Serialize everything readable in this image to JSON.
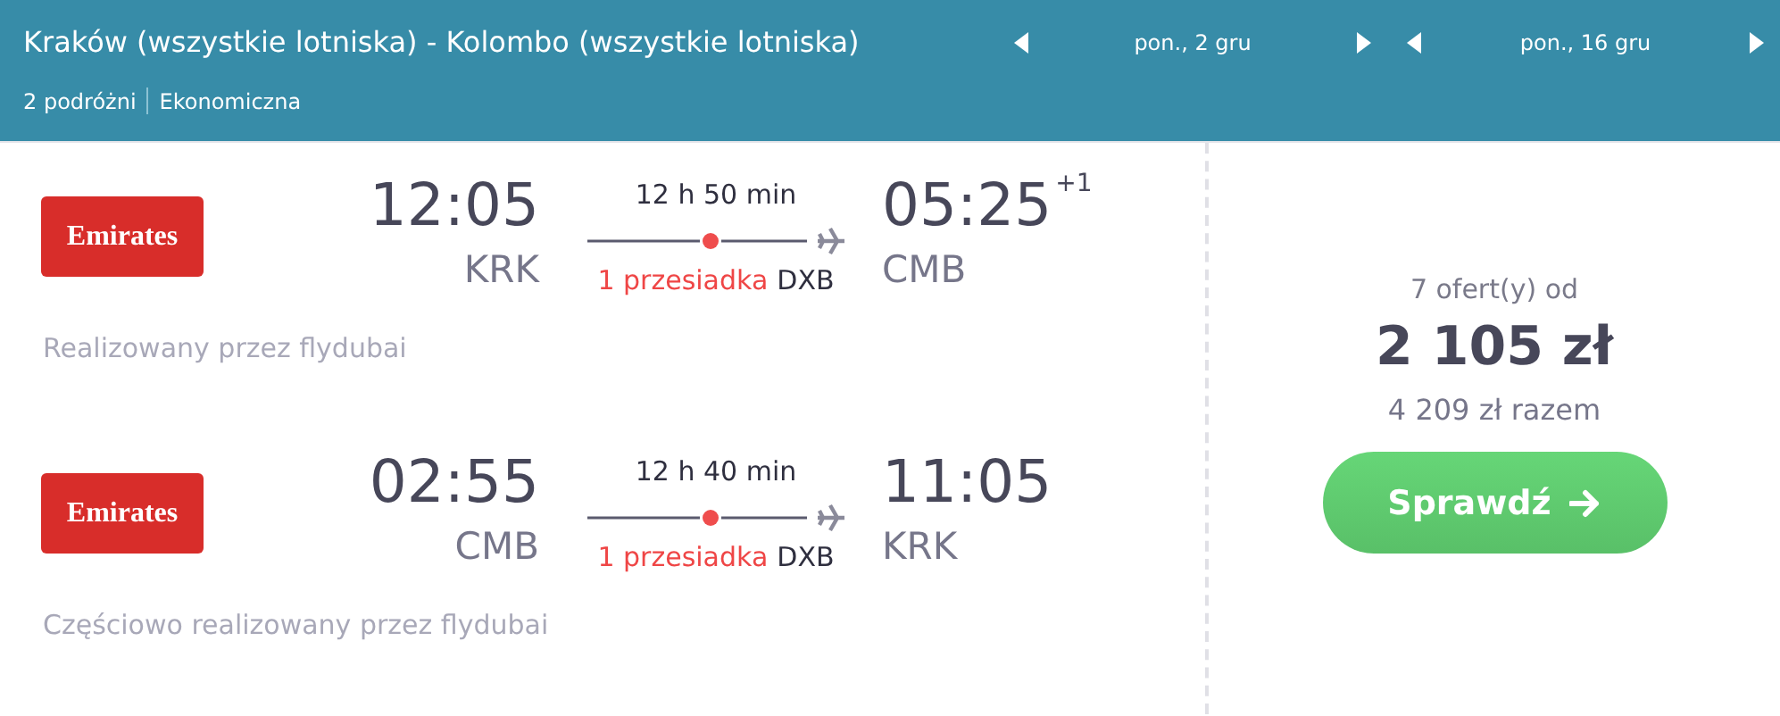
{
  "header": {
    "route": "Kraków (wszystkie lotniska) - Kolombo (wszystkie lotniska)",
    "travellers": "2 podróżni",
    "cabin": "Ekonomiczna",
    "dates": [
      "pon., 2 gru",
      "pon., 16 gru"
    ]
  },
  "legs": [
    {
      "airline": "Emirates",
      "departure_time": "12:05",
      "departure_airport": "KRK",
      "duration": "12 h 50 min",
      "stops": "1 przesiadka",
      "stop_airport": "DXB",
      "arrival_time": "05:25",
      "day_offset": "+1",
      "arrival_airport": "CMB",
      "operated_by": "Realizowany przez flydubai"
    },
    {
      "airline": "Emirates",
      "departure_time": "02:55",
      "departure_airport": "CMB",
      "duration": "12 h 40 min",
      "stops": "1 przesiadka",
      "stop_airport": "DXB",
      "arrival_time": "11:05",
      "arrival_airport": "KRK",
      "operated_by": "Częściowo realizowany przez flydubai"
    }
  ],
  "price": {
    "offers": "7 ofert(y) od",
    "amount": "2 105 zł",
    "total": "4 209 zł razem",
    "button": "Sprawdź"
  }
}
